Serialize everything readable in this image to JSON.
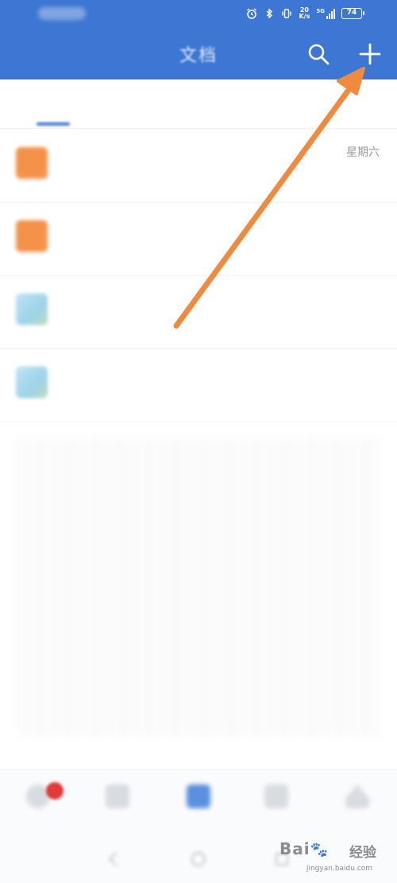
{
  "status_bar": {
    "time": "",
    "network_speed_value": "20",
    "network_speed_unit": "K/s",
    "signal_label": "5G",
    "battery": "74"
  },
  "header": {
    "title": "文档",
    "search_icon": "search-icon",
    "add_icon": "plus-icon"
  },
  "tabs": [
    {
      "label": ""
    },
    {
      "label": ""
    }
  ],
  "files": [
    {
      "name": "",
      "subtitle": "",
      "date": "星期六",
      "icon": "orange-doc-icon"
    },
    {
      "name": "",
      "subtitle": "",
      "date": "",
      "icon": "orange-doc-icon"
    },
    {
      "name": "",
      "subtitle": "",
      "date": "",
      "icon": "blue-image-icon"
    },
    {
      "name": "",
      "subtitle": "",
      "date": "",
      "icon": "blue-image-icon"
    }
  ],
  "bottom_nav": [
    {
      "label": "",
      "icon": "message-icon"
    },
    {
      "label": "",
      "icon": "contacts-icon"
    },
    {
      "label": "",
      "icon": "document-icon",
      "active": true
    },
    {
      "label": "",
      "icon": "workbench-icon"
    },
    {
      "label": "",
      "icon": "profile-icon"
    }
  ],
  "watermark": {
    "logo": "Bai🐾",
    "logo_text": "Bai",
    "cn": "经验",
    "url": "jingyan.baidu.com"
  },
  "colors": {
    "header_bg": "#3d77d3",
    "arrow": "#f08a3e",
    "orange_icon": "#f5924a",
    "badge": "#e03a3a"
  }
}
